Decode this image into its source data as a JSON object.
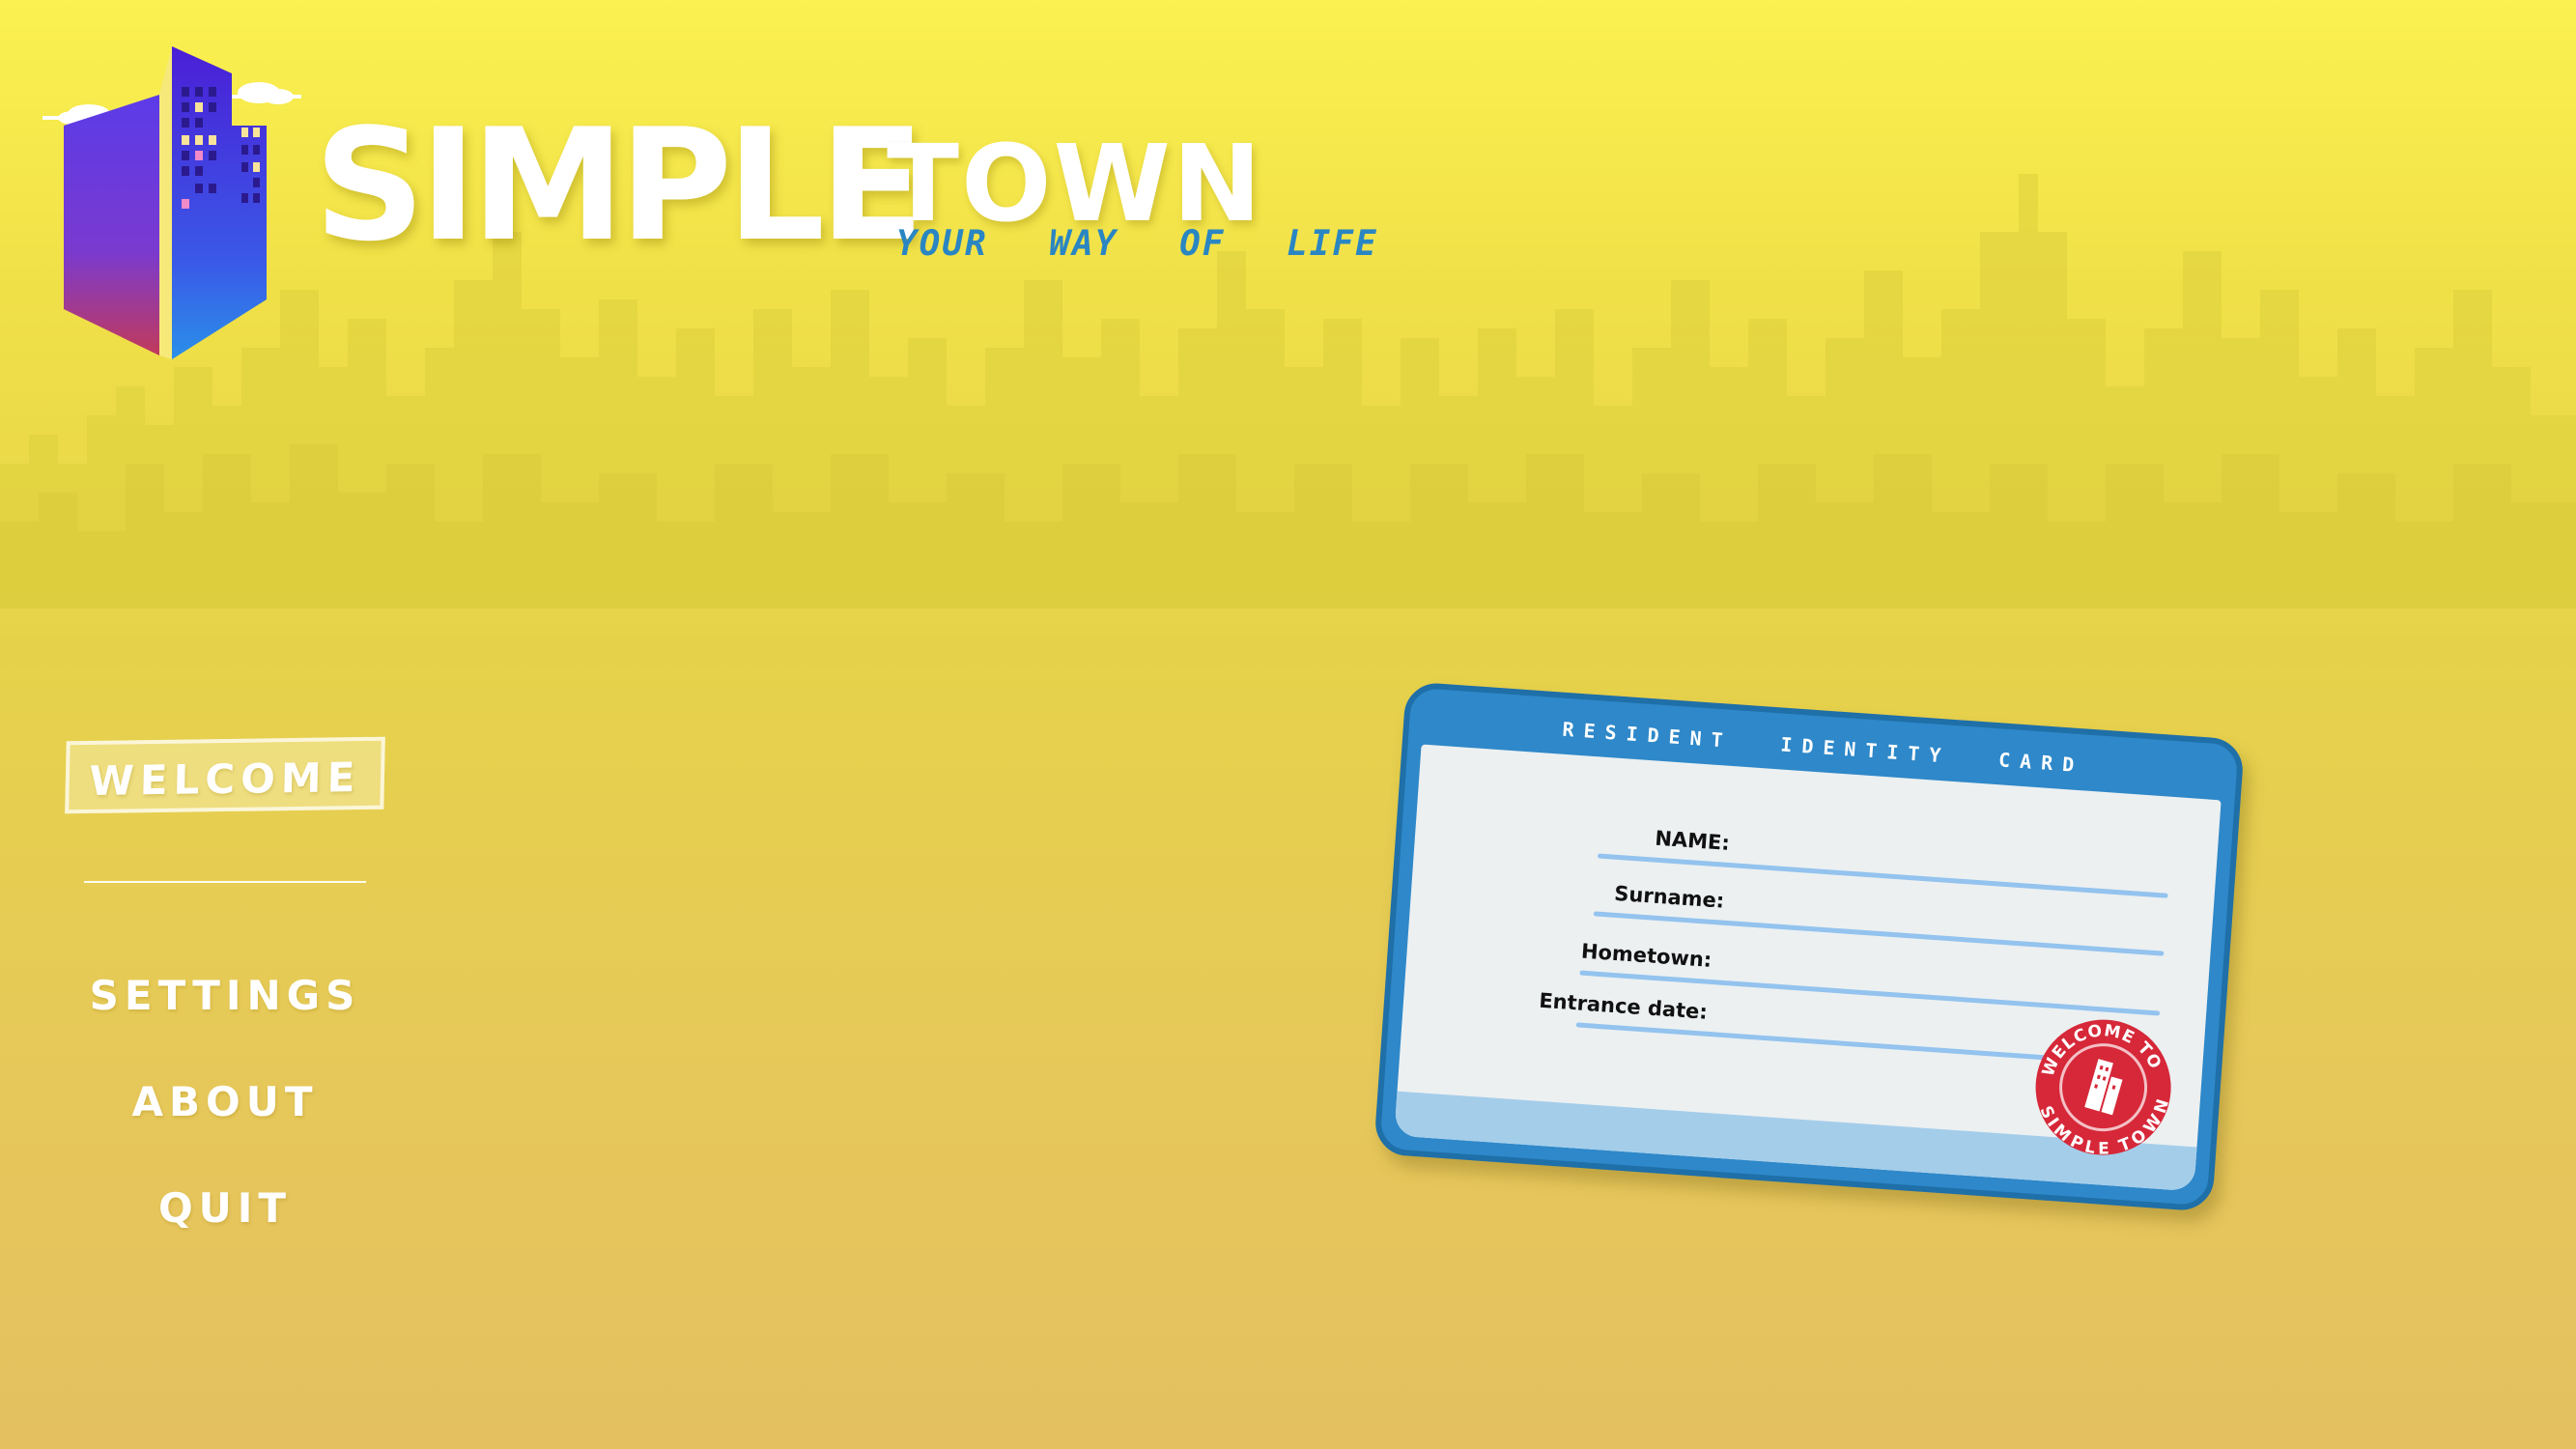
{
  "title": {
    "word1": "SIMPLE",
    "word2": "TOWN",
    "tagline": "YOUR WAY OF LIFE"
  },
  "menu": {
    "items": [
      {
        "label": "WELCOME",
        "selected": true
      },
      {
        "label": "SETTINGS"
      },
      {
        "label": "ABOUT"
      },
      {
        "label": "QUIT"
      }
    ]
  },
  "id_card": {
    "header": "RESIDENT IDENTITY CARD",
    "fields": [
      {
        "label": "NAME:"
      },
      {
        "label": "Surname:"
      },
      {
        "label": "Hometown:"
      },
      {
        "label": "Entrance date:"
      }
    ],
    "stamp": {
      "top_text": "WELCOME TO",
      "bottom_text": "SIMPLE TOWN"
    }
  },
  "colors": {
    "background_top": "#fbf150",
    "background_bottom": "#e4c060",
    "card_blue": "#2e88c9",
    "tagline_blue": "#2a86c2",
    "stamp_red": "#d62839"
  }
}
